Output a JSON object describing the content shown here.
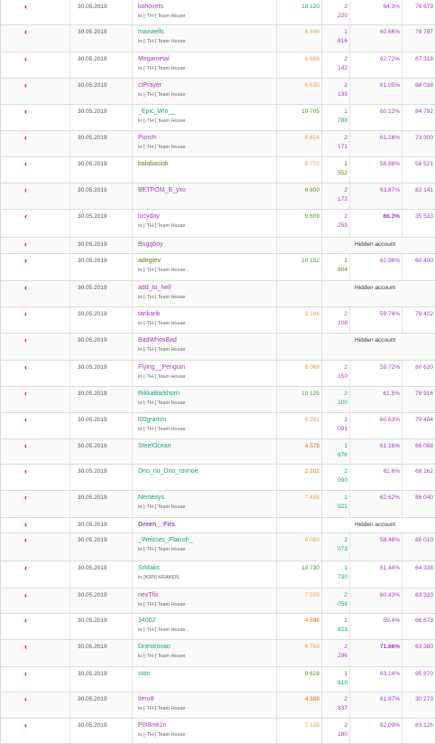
{
  "team_label": "Team House",
  "hidden_label": "Hidden account",
  "rows": [
    {
      "date": "30.05.2019",
      "name": "kohovets",
      "name_color": "purple",
      "team": "to [-TH-] Team House",
      "score": "18 120",
      "score_color": "teal",
      "ppp1": "2",
      "ppp2": "220",
      "ppp_color": "purple",
      "win": "64.3%",
      "win_bold": false,
      "elo": "76 679",
      "hidden": false
    },
    {
      "date": "30.05.2019",
      "name": "maxwells",
      "name_color": "teal",
      "team": "to [-TH-] Team House",
      "score": "6 849",
      "score_color": "orange",
      "ppp1": "1",
      "ppp2": "816",
      "ppp_color": "purple",
      "win": "60.66%",
      "win_bold": false,
      "elo": "78 787",
      "hidden": false
    },
    {
      "date": "30.05.2019",
      "name": "Megametal",
      "name_color": "purple",
      "team": "to [-TH-] Team House",
      "score": "6 888",
      "score_color": "orange",
      "ppp1": "2",
      "ppp2": "142",
      "ppp_color": "purple",
      "win": "62.72%",
      "win_bold": false,
      "elo": "67 318",
      "hidden": false
    },
    {
      "date": "30.05.2019",
      "name": "ctPrayer",
      "name_color": "purple",
      "team": "to [-TH-] Team House",
      "score": "6 630",
      "score_color": "orange",
      "ppp1": "2",
      "ppp2": "139",
      "ppp_color": "purple",
      "win": "61.05%",
      "win_bold": false,
      "elo": "88 038",
      "hidden": false
    },
    {
      "date": "30.05.2019",
      "name": "_Epic_Win__",
      "name_color": "teal",
      "team": "to [-TH-] Team House",
      "score": "10 705",
      "score_color": "green",
      "ppp1": "1",
      "ppp2": "788",
      "ppp_color": "teal",
      "win": "60.12%",
      "win_bold": false,
      "elo": "84 792",
      "hidden": false
    },
    {
      "date": "30.05.2019",
      "name": "Punch",
      "name_color": "purple",
      "team": "to [-TH-] Team House",
      "score": "8 854",
      "score_color": "orange",
      "ppp1": "2",
      "ppp2": "171",
      "ppp_color": "purple",
      "win": "61.16%",
      "win_bold": false,
      "elo": "73 300",
      "hidden": false
    },
    {
      "date": "30.05.2019",
      "name": "balabasiok",
      "name_color": "olive",
      "team": "",
      "score": "6 703",
      "score_color": "orange",
      "ppp1": "1",
      "ppp2": "552",
      "ppp_color": "olive",
      "win": "58.88%",
      "win_bold": false,
      "elo": "58 521",
      "hidden": false
    },
    {
      "date": "30.05.2019",
      "name": "BETPOM_B_yxo",
      "name_color": "purple",
      "team": "",
      "score": "9 800",
      "score_color": "green",
      "ppp1": "2",
      "ppp2": "172",
      "ppp_color": "purple",
      "win": "63.87%",
      "win_bold": false,
      "elo": "82 141",
      "hidden": false
    },
    {
      "date": "30.05.2019",
      "name": "lucyday",
      "name_color": "purple",
      "team": "to [-TH-] Team House",
      "score": "9 609",
      "score_color": "green",
      "ppp1": "2",
      "ppp2": "259",
      "ppp_color": "purple",
      "win": "66.3%",
      "win_bold": true,
      "elo": "35 533",
      "hidden": false
    },
    {
      "date": "30.05.2019",
      "name": "Buggboy",
      "name_color": "purple",
      "team": "",
      "hidden": true
    },
    {
      "date": "30.05.2019",
      "name": "adegtev",
      "name_color": "olive",
      "team": "to [-TH-] Team House",
      "score": "10 152",
      "score_color": "green",
      "ppp1": "1",
      "ppp2": "804",
      "ppp_color": "olive",
      "win": "62.96%",
      "win_bold": false,
      "elo": "60 400",
      "hidden": false
    },
    {
      "date": "30.05.2019",
      "name": "add_to_hell",
      "name_color": "purple",
      "team": "to [-TH-] Team House",
      "hidden": true
    },
    {
      "date": "30.05.2019",
      "name": "tarikarik",
      "name_color": "purple",
      "team": "to [-TH-] Team House",
      "score": "8 186",
      "score_color": "orange",
      "ppp1": "2",
      "ppp2": "108",
      "ppp_color": "purple",
      "win": "59.74%",
      "win_bold": false,
      "elo": "79 422",
      "hidden": false
    },
    {
      "date": "30.05.2019",
      "name": "BadWhosBad",
      "name_color": "purple",
      "team": "to [-TH-] Team House",
      "hidden": true
    },
    {
      "date": "30.05.2019",
      "name": "Flying__Penguin",
      "name_color": "purple",
      "team": "to [-TH-] Team House",
      "score": "6 068",
      "score_color": "orange",
      "ppp1": "2",
      "ppp2": "150",
      "ppp_color": "purple",
      "win": "59.72%",
      "win_bold": false,
      "elo": "80 620",
      "hidden": false
    },
    {
      "date": "30.05.2019",
      "name": "RikkaBarkhorn",
      "name_color": "teal",
      "team": "to [-TH-] Team House",
      "score": "10 125",
      "score_color": "green",
      "ppp1": "2",
      "ppp2": "100",
      "ppp_color": "teal",
      "win": "61.5%",
      "win_bold": false,
      "elo": "78 916",
      "hidden": false
    },
    {
      "date": "30.05.2019",
      "name": "l00gramm",
      "name_color": "teal",
      "team": "to [-TH-] Team House",
      "score": "6 281",
      "score_color": "orange",
      "ppp1": "2",
      "ppp2": "091",
      "ppp_color": "purple",
      "win": "60.63%",
      "win_bold": false,
      "elo": "79 484",
      "hidden": false
    },
    {
      "date": "30.05.2019",
      "name": "SteelOcean",
      "name_color": "teal",
      "team": "",
      "score": "4 578",
      "score_color": "darkorange",
      "ppp1": "1",
      "ppp2": "876",
      "ppp_color": "teal",
      "win": "61.16%",
      "win_bold": false,
      "elo": "68 088",
      "hidden": false
    },
    {
      "date": "30.05.2019",
      "name": "Dno_no_Dno_rovnoe",
      "name_color": "teal",
      "team": "",
      "score": "2 202",
      "score_color": "darkorange",
      "ppp1": "2",
      "ppp2": "090",
      "ppp_color": "teal",
      "win": "61.6%",
      "win_bold": false,
      "elo": "68 162",
      "hidden": false
    },
    {
      "date": "30.05.2019",
      "name": "Nemesys",
      "name_color": "teal",
      "team": "to [-TH-] Team House",
      "score": "7 486",
      "score_color": "orange",
      "ppp1": "1",
      "ppp2": "921",
      "ppp_color": "teal",
      "win": "62.62%",
      "win_bold": false,
      "elo": "86 040",
      "hidden": false
    },
    {
      "date": "30.05.2019",
      "name": "Green__Firs",
      "name_color": "purple",
      "name_bold": true,
      "team": "",
      "hidden": true
    },
    {
      "date": "30.05.2019",
      "name": "_Weissec_Flaicoh_",
      "name_color": "teal",
      "team": "to [-TH-] Team House",
      "score": "6 080",
      "score_color": "orange",
      "ppp1": "2",
      "ppp2": "073",
      "ppp_color": "teal",
      "win": "58.48%",
      "win_bold": false,
      "elo": "80 010",
      "hidden": false
    },
    {
      "date": "30.05.2019",
      "name": "SrMaks",
      "name_color": "teal",
      "team": "to [KRN] KRAKEN.",
      "score": "10 730",
      "score_color": "green",
      "ppp1": "1",
      "ppp2": "730",
      "ppp_color": "teal",
      "win": "61.44%",
      "win_bold": false,
      "elo": "64 338",
      "hidden": false
    },
    {
      "date": "30.05.2019",
      "name": "nexTfix",
      "name_color": "purple",
      "team": "to [-TH-] Team House",
      "score": "7 599",
      "score_color": "orange",
      "ppp1": "2",
      "ppp2": "058",
      "ppp_color": "teal",
      "win": "60.43%",
      "win_bold": false,
      "elo": "63 333",
      "hidden": false
    },
    {
      "date": "30.05.2019",
      "name": "34002",
      "name_color": "teal",
      "team": "to [-TH-] Team House",
      "score": "4 896",
      "score_color": "darkorange",
      "ppp1": "1",
      "ppp2": "823",
      "ppp_color": "teal",
      "win": "59.4%",
      "win_bold": false,
      "elo": "66 673",
      "hidden": false
    },
    {
      "date": "30.05.2019",
      "name": "Dnestrovao",
      "name_color": "teal",
      "team": "to [-TH-] Team House",
      "score": "6 769",
      "score_color": "orange",
      "ppp1": "2",
      "ppp2": "296",
      "ppp_color": "purple",
      "win": "71.86%",
      "win_bold": true,
      "elo": "63 380",
      "hidden": false
    },
    {
      "date": "30.05.2019",
      "name": "stoo",
      "name_color": "teal",
      "team": "",
      "score": "9 628",
      "score_color": "green",
      "ppp1": "1",
      "ppp2": "818",
      "ppp_color": "teal",
      "win": "63.14%",
      "win_bold": false,
      "elo": "95 870",
      "hidden": false
    },
    {
      "date": "30.05.2019",
      "name": "tiero8",
      "name_color": "purple",
      "team": "to [-TH-] Team House",
      "score": "4 389",
      "score_color": "darkorange",
      "ppp1": "2",
      "ppp2": "337",
      "ppp_color": "purple",
      "win": "61.97%",
      "win_bold": false,
      "elo": "30 273",
      "hidden": false
    },
    {
      "date": "30.05.2019",
      "name": "P0t8mk1n",
      "name_color": "purple",
      "team": "to [-TH-] Team House",
      "score": "7 108",
      "score_color": "orange",
      "ppp1": "2",
      "ppp2": "180",
      "ppp_color": "purple",
      "win": "62.09%",
      "win_bold": false,
      "elo": "83 126",
      "hidden": false
    }
  ]
}
